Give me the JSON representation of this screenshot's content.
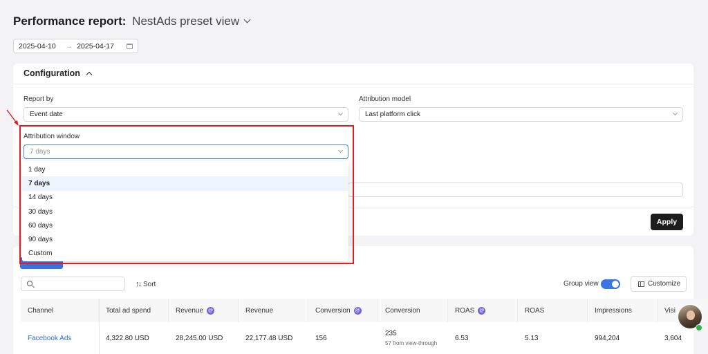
{
  "header": {
    "title": "Performance report:",
    "preset": "NestAds preset view"
  },
  "date_range": {
    "start": "2025-04-10",
    "arrow": "→",
    "end": "2025-04-17"
  },
  "configuration": {
    "title": "Configuration",
    "report_by": {
      "label": "Report by",
      "value": "Event date"
    },
    "attribution_model": {
      "label": "Attribution model",
      "value": "Last platform click"
    },
    "attribution_window": {
      "label": "Attribution window",
      "value": "7 days",
      "options": [
        "1 day",
        "7 days",
        "14 days",
        "30 days",
        "60 days",
        "90 days",
        "Custom"
      ],
      "selected_index": 1
    },
    "apply_label": "Apply"
  },
  "toolbar": {
    "sort_label": "Sort",
    "group_view_label": "Group view",
    "group_view_on": true,
    "customize_label": "Customize"
  },
  "table": {
    "columns": [
      "Channel",
      "Total ad spend",
      "Revenue",
      "Revenue",
      "Conversion",
      "Conversion",
      "ROAS",
      "ROAS",
      "Impressions",
      "Visi"
    ],
    "badged_columns": [
      2,
      4,
      6
    ],
    "badge_glyph": "@",
    "rows": [
      {
        "channel": "Facebook Ads",
        "total_ad_spend": "4,322.80 USD",
        "revenue_nestads": "28,245.00 USD",
        "revenue_platform": "22,177.48 USD",
        "conversion_nestads": "156",
        "conversion_platform": "235",
        "conversion_note": "57 from view-through",
        "roas_nestads": "6.53",
        "roas_platform": "5.13",
        "impressions": "994,204",
        "visits": "3,604"
      }
    ]
  },
  "colors": {
    "accent": "#3b74e5",
    "badge": "#7063d4",
    "highlight_box": "#e31b23",
    "link": "#2d6fd8"
  }
}
